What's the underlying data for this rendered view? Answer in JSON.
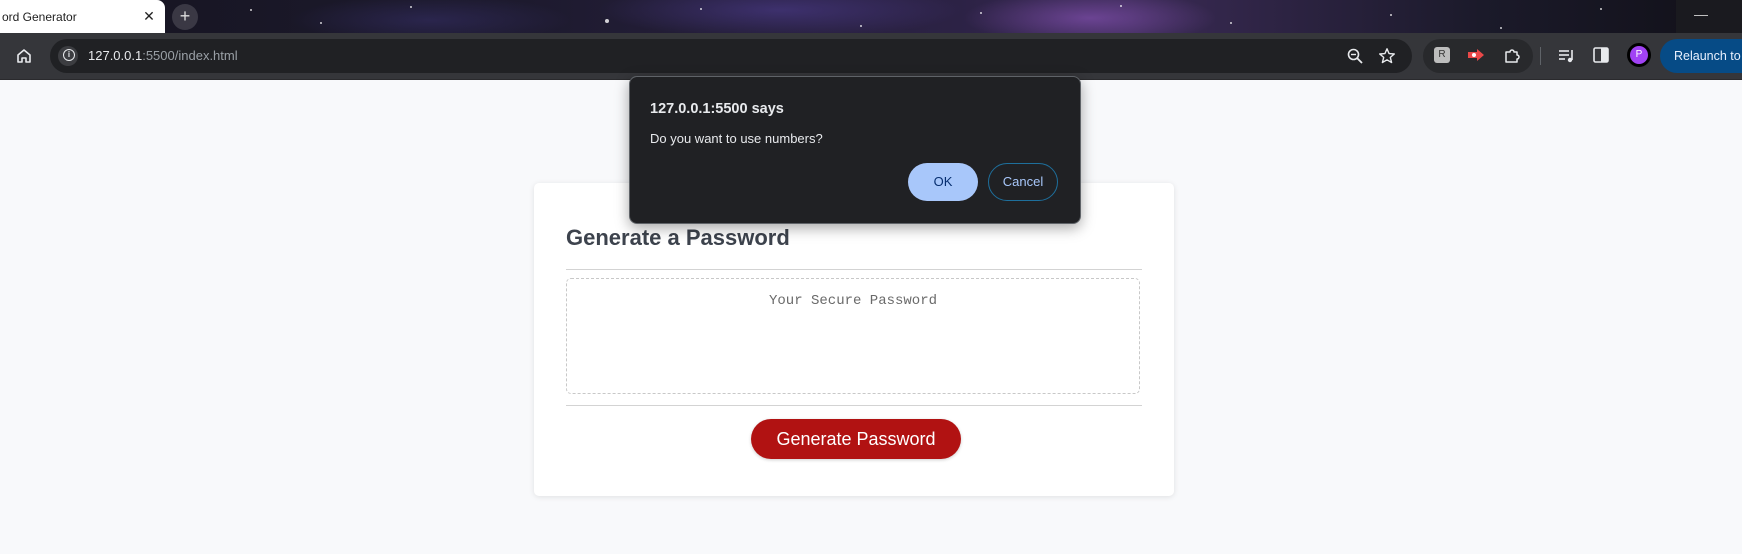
{
  "browser": {
    "tab_title": "ord Generator",
    "tab_close_glyph": "✕",
    "new_tab_glyph": "+",
    "minimize_glyph": "—",
    "url_host": "127.0.0.1",
    "url_path": ":5500/index.html",
    "profile_initial": "P",
    "relaunch_label": "Relaunch to u",
    "ext_label": "R"
  },
  "dialog": {
    "title": "127.0.0.1:5500 says",
    "message": "Do you want to use numbers?",
    "ok_label": "OK",
    "cancel_label": "Cancel"
  },
  "page": {
    "card_title": "Generate a Password",
    "password_placeholder": "Your Secure Password",
    "generate_label": "Generate Password",
    "accent_color": "#b11212"
  }
}
